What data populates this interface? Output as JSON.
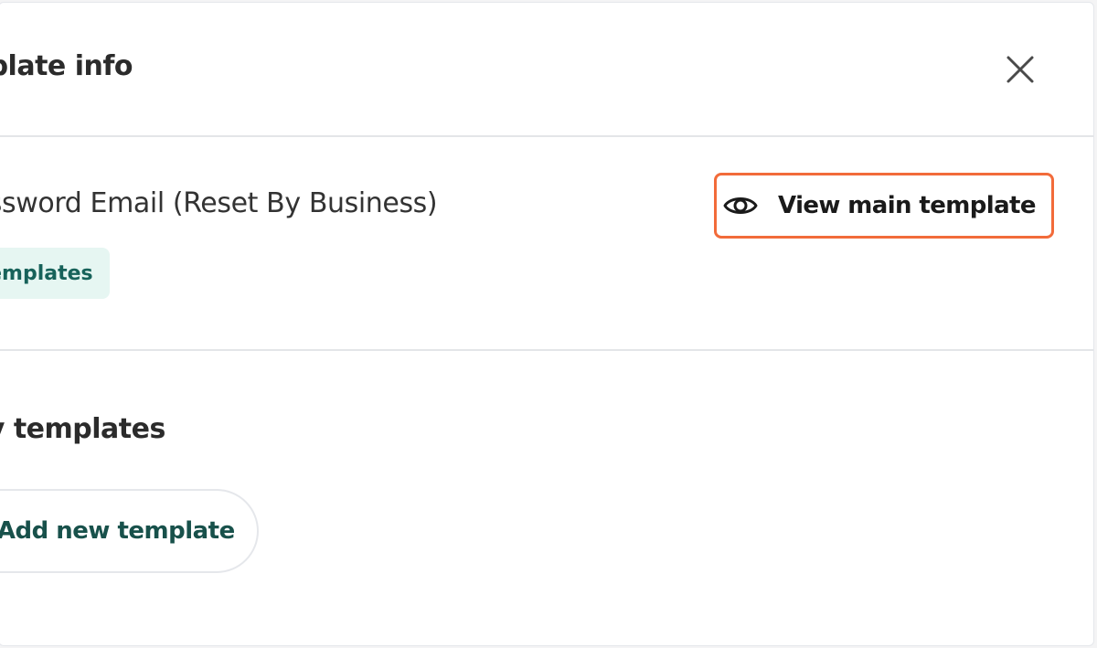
{
  "header": {
    "title": "Template info",
    "close_icon": "close-icon"
  },
  "template": {
    "name": "Prod: Change Password Email (Reset By Business)",
    "view_button_label": "View main template",
    "view_button_icon": "eye-icon",
    "tag_label": "Main templates"
  },
  "auxiliary": {
    "title": "Auxiliary templates",
    "add_button_label": "+ Add new template"
  },
  "colors": {
    "highlight_border": "#f26b3a",
    "tag_background": "#e6f6f2",
    "tag_text": "#17625a",
    "add_button_text": "#18514b"
  }
}
